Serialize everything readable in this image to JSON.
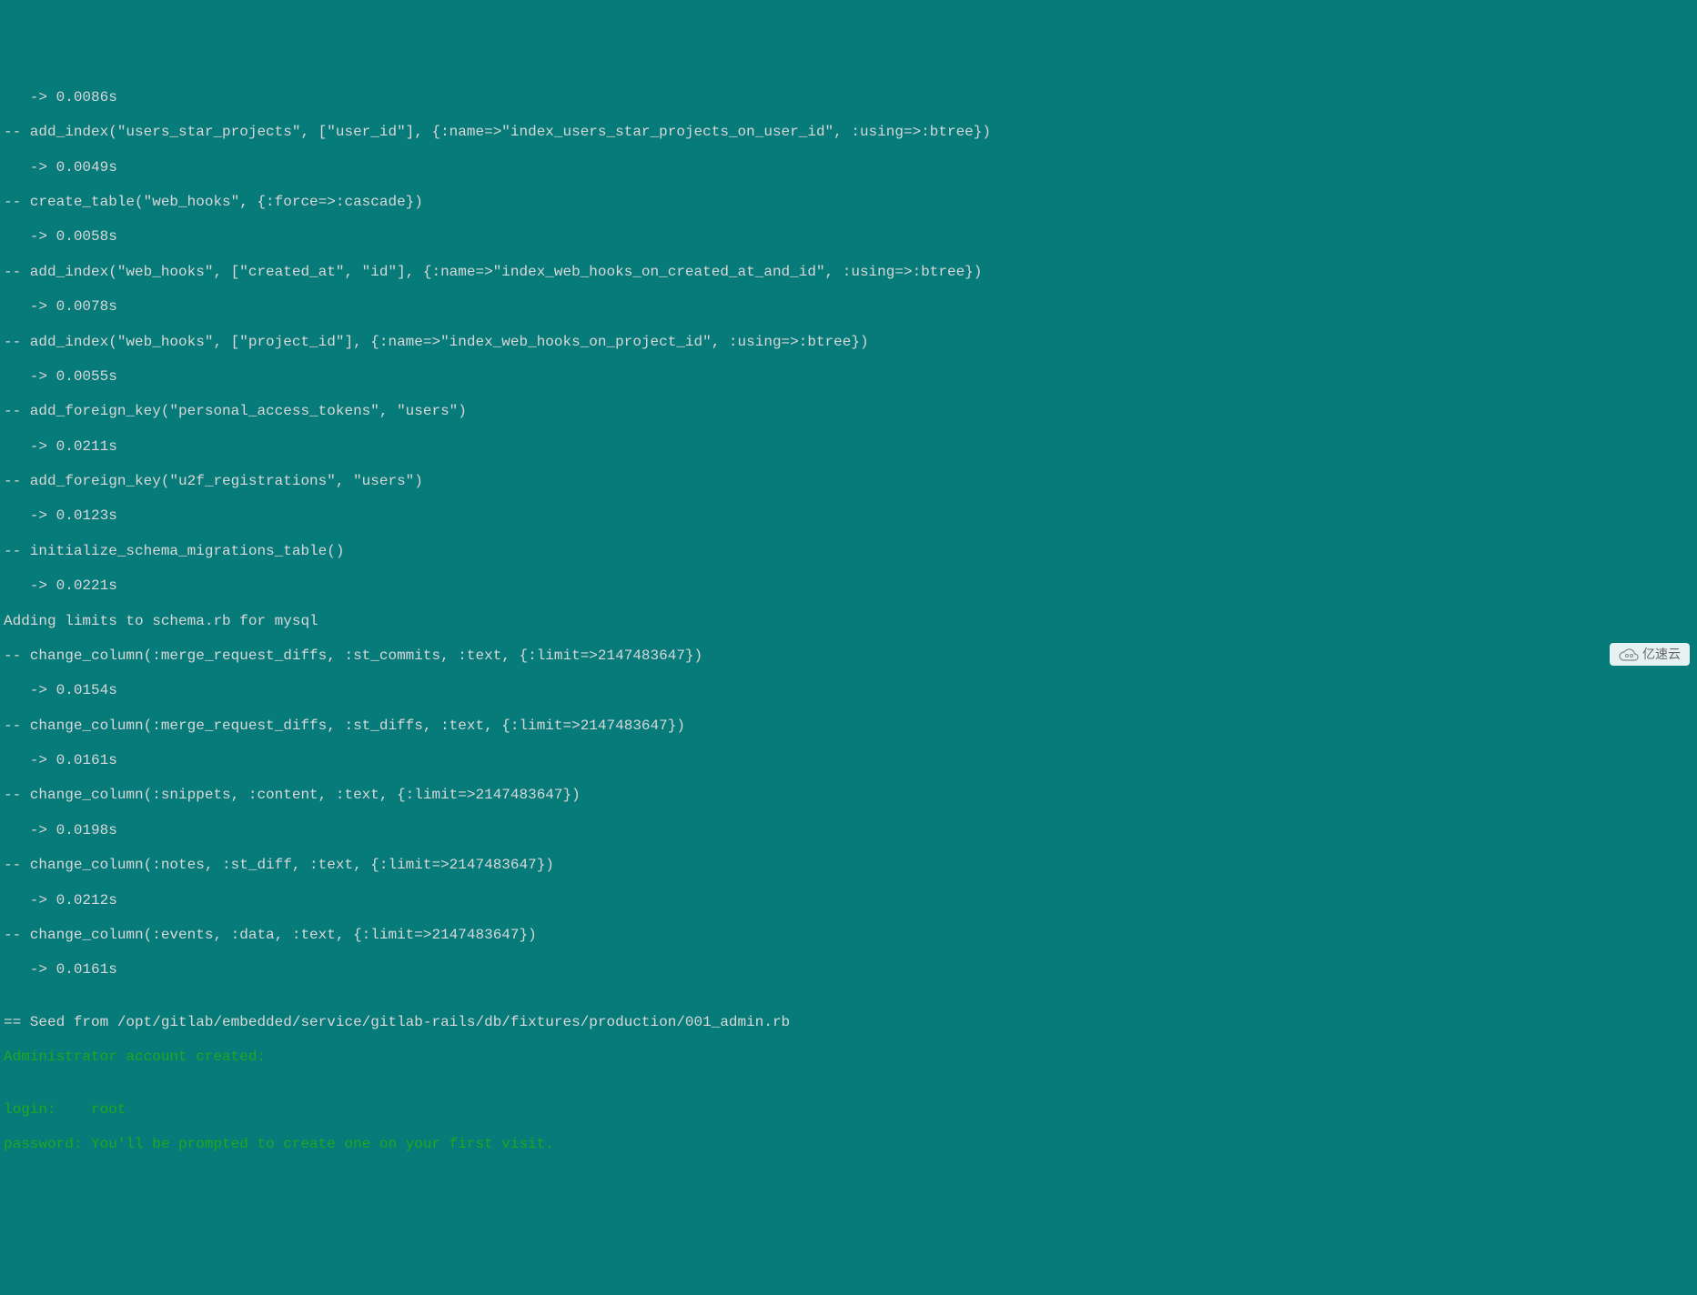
{
  "terminal": {
    "lines": [
      "   -> 0.0086s",
      "-- add_index(\"users_star_projects\", [\"user_id\"], {:name=>\"index_users_star_projects_on_user_id\", :using=>:btree})",
      "   -> 0.0049s",
      "-- create_table(\"web_hooks\", {:force=>:cascade})",
      "   -> 0.0058s",
      "-- add_index(\"web_hooks\", [\"created_at\", \"id\"], {:name=>\"index_web_hooks_on_created_at_and_id\", :using=>:btree})",
      "   -> 0.0078s",
      "-- add_index(\"web_hooks\", [\"project_id\"], {:name=>\"index_web_hooks_on_project_id\", :using=>:btree})",
      "   -> 0.0055s",
      "-- add_foreign_key(\"personal_access_tokens\", \"users\")",
      "   -> 0.0211s",
      "-- add_foreign_key(\"u2f_registrations\", \"users\")",
      "   -> 0.0123s",
      "-- initialize_schema_migrations_table()",
      "   -> 0.0221s",
      "Adding limits to schema.rb for mysql",
      "-- change_column(:merge_request_diffs, :st_commits, :text, {:limit=>2147483647})",
      "   -> 0.0154s",
      "-- change_column(:merge_request_diffs, :st_diffs, :text, {:limit=>2147483647})",
      "   -> 0.0161s",
      "-- change_column(:snippets, :content, :text, {:limit=>2147483647})",
      "   -> 0.0198s",
      "-- change_column(:notes, :st_diff, :text, {:limit=>2147483647})",
      "   -> 0.0212s",
      "-- change_column(:events, :data, :text, {:limit=>2147483647})",
      "   -> 0.0161s",
      "",
      "== Seed from /opt/gitlab/embedded/service/gitlab-rails/db/fixtures/production/001_admin.rb"
    ],
    "green_lines": [
      "Administrator account created:",
      "",
      "login:    root",
      "password: You'll be prompted to create one on your first visit."
    ]
  },
  "watermark": {
    "text": "亿速云"
  }
}
